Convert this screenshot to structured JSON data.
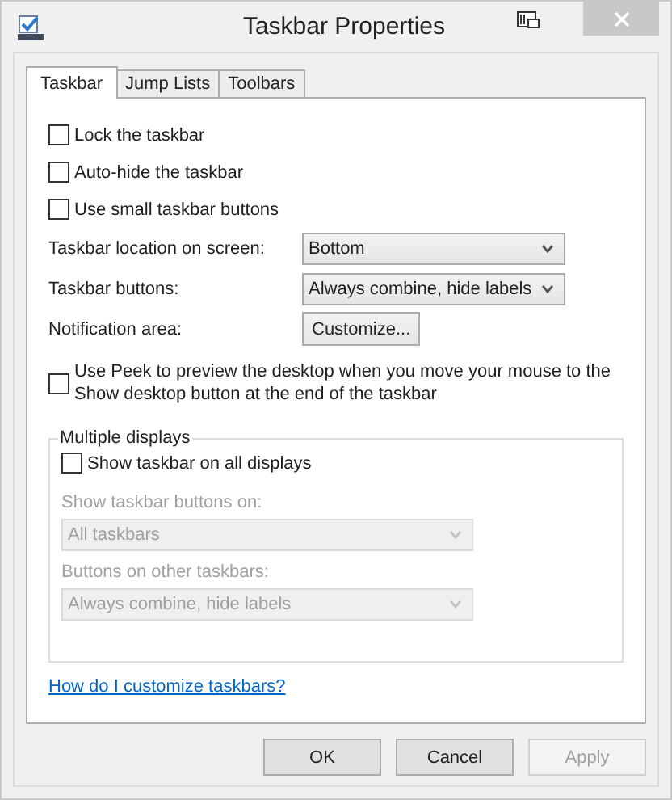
{
  "window": {
    "title": "Taskbar Properties"
  },
  "tabs": [
    {
      "label": "Taskbar",
      "selected": true
    },
    {
      "label": "Jump Lists",
      "selected": false
    },
    {
      "label": "Toolbars",
      "selected": false
    }
  ],
  "settings": [
    {
      "kind": "checkbox",
      "label": "Lock the taskbar",
      "checked": false
    },
    {
      "kind": "checkbox",
      "label": "Auto-hide the taskbar",
      "checked": false
    },
    {
      "kind": "checkbox",
      "label": "Use small taskbar buttons",
      "checked": false
    },
    {
      "kind": "dropdown",
      "label": "Taskbar location on screen:",
      "value": "Bottom"
    },
    {
      "kind": "dropdown",
      "label": "Taskbar buttons:",
      "value": "Always combine, hide labels"
    },
    {
      "kind": "button",
      "label": "Notification area:",
      "button": "Customize..."
    },
    {
      "kind": "checkbox",
      "label": "Use Peek to preview the desktop when you move your mouse to the Show desktop button at the end of the taskbar",
      "checked": false
    }
  ],
  "group": {
    "title": "Multiple displays",
    "items": [
      {
        "kind": "checkbox",
        "label": "Show taskbar on all displays",
        "checked": false
      },
      {
        "kind": "dropdown",
        "label": "Show taskbar buttons on:",
        "value": "All taskbars",
        "disabled": true
      },
      {
        "kind": "dropdown",
        "label": "Buttons on other taskbars:",
        "value": "Always combine, hide labels",
        "disabled": true
      }
    ]
  },
  "help_link": "How do I customize taskbars?",
  "buttons": [
    {
      "label": "OK",
      "disabled": false
    },
    {
      "label": "Cancel",
      "disabled": false
    },
    {
      "label": "Apply",
      "disabled": true
    }
  ]
}
